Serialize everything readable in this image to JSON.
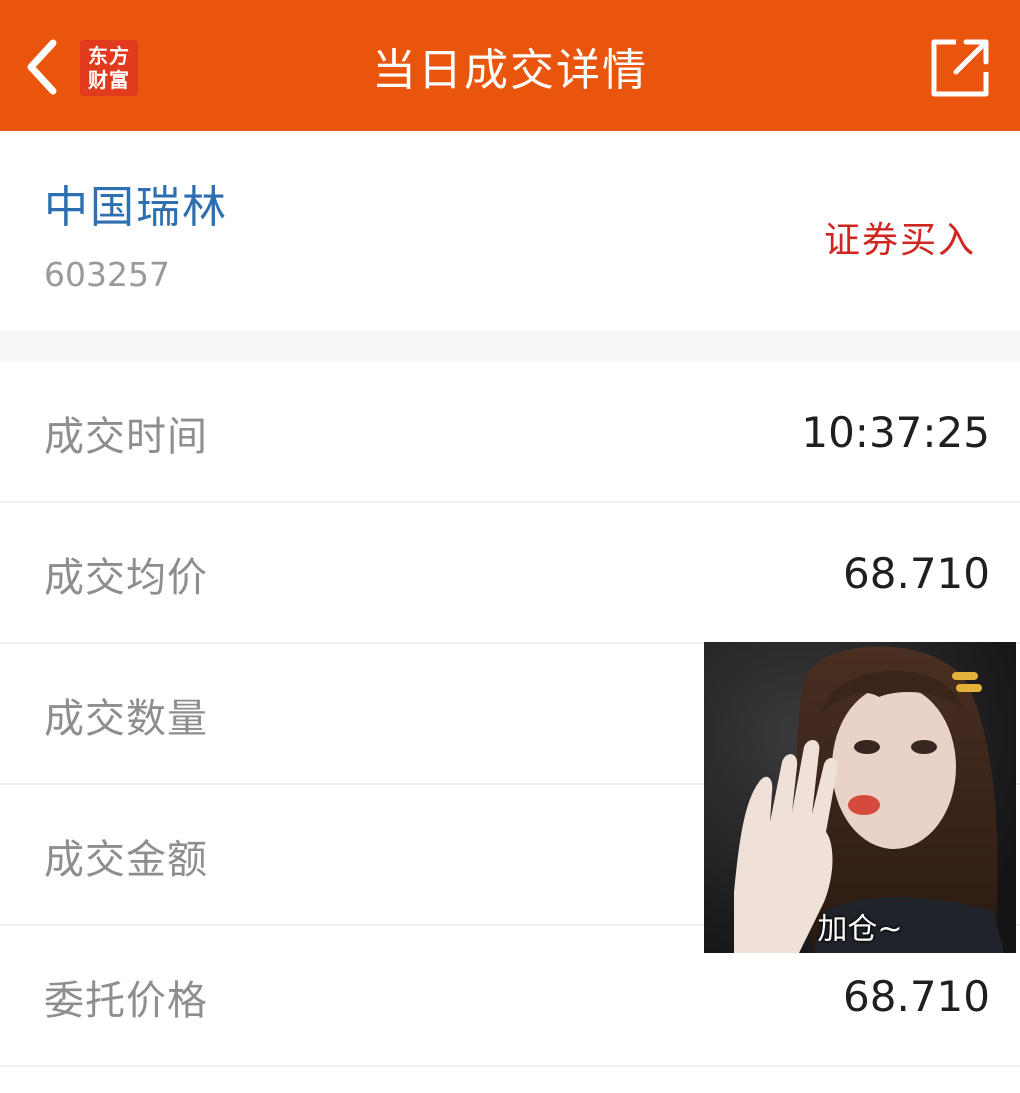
{
  "header": {
    "title": "当日成交详情",
    "brand_line1": "东方",
    "brand_line2": "财富",
    "back_icon": "chevron-left-icon",
    "share_icon": "share-out-icon",
    "background_color": "#e9550c"
  },
  "stock": {
    "name": "中国瑞林",
    "code": "603257",
    "trade_type": "证券买入",
    "name_color": "#2d6fb0",
    "trade_type_color": "#d0261f"
  },
  "details": [
    {
      "label": "成交时间",
      "value": "10:37:25"
    },
    {
      "label": "成交均价",
      "value": "68.710"
    },
    {
      "label": "成交数量",
      "value": ""
    },
    {
      "label": "成交金额",
      "value": ""
    },
    {
      "label": "委托价格",
      "value": "68.710"
    }
  ],
  "sticker": {
    "caption": "加仓~"
  }
}
